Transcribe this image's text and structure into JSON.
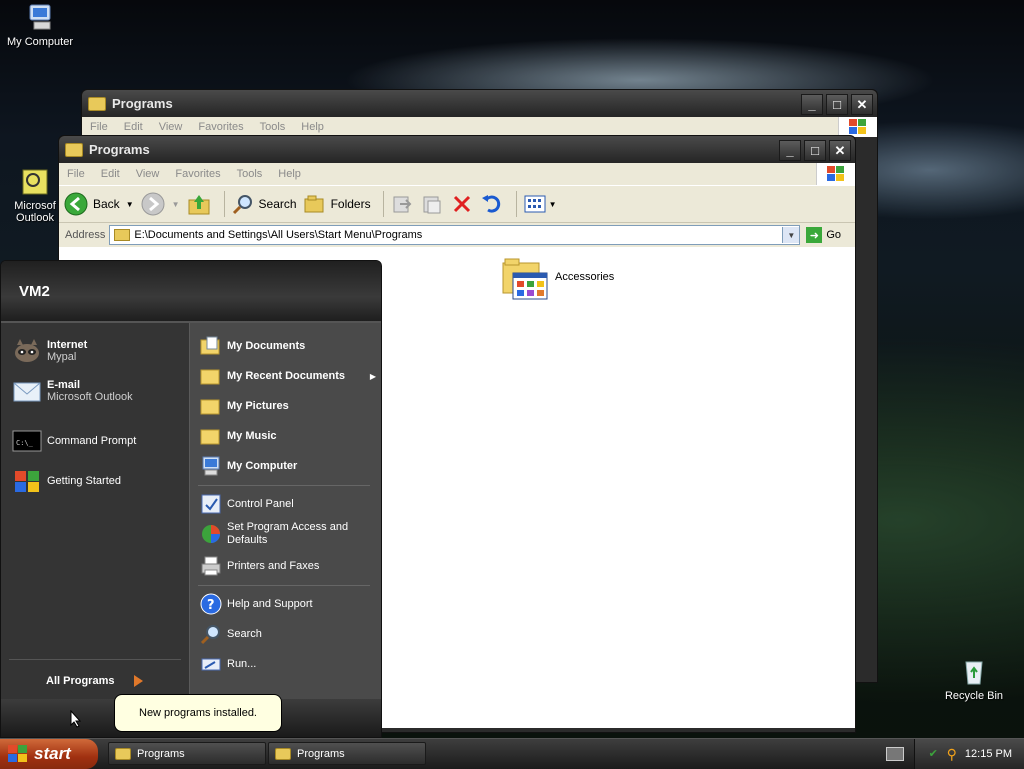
{
  "desktop": {
    "icons": [
      {
        "label": "My Computer",
        "icon": "my-computer-icon"
      },
      {
        "label": "Microsof Outlook",
        "icon": "outlook-icon"
      },
      {
        "label": "Recycle Bin",
        "icon": "recycle-bin-icon"
      }
    ]
  },
  "back_window": {
    "title": "Programs",
    "menu": [
      "File",
      "Edit",
      "View",
      "Favorites",
      "Tools",
      "Help"
    ]
  },
  "front_window": {
    "title": "Programs",
    "menu": [
      "File",
      "Edit",
      "View",
      "Favorites",
      "Tools",
      "Help"
    ],
    "toolbar": {
      "back_label": "Back",
      "search_label": "Search",
      "folders_label": "Folders"
    },
    "address": {
      "label": "Address",
      "value": "E:\\Documents and Settings\\All Users\\Start Menu\\Programs",
      "go_label": "Go"
    },
    "items": [
      {
        "label": "Accessories",
        "icon": "accessories-folder-icon"
      }
    ]
  },
  "start_menu": {
    "user": "VM2",
    "pinned": [
      {
        "title": "Internet",
        "subtitle": "Mypal",
        "icon": "mypal-raccoon-icon"
      },
      {
        "title": "E-mail",
        "subtitle": "Microsoft Outlook",
        "icon": "email-envelope-icon"
      }
    ],
    "recent": [
      {
        "label": "Command Prompt",
        "icon": "command-prompt-icon"
      },
      {
        "label": "Getting Started",
        "icon": "windows-flag-icon"
      }
    ],
    "all_programs": "All Programs",
    "places": [
      {
        "label": "My Documents",
        "icon": "my-documents-icon",
        "bold": true
      },
      {
        "label": "My Recent Documents",
        "icon": "recent-documents-icon",
        "bold": true,
        "submenu": true
      },
      {
        "label": "My Pictures",
        "icon": "my-pictures-icon",
        "bold": true
      },
      {
        "label": "My Music",
        "icon": "my-music-icon",
        "bold": true
      },
      {
        "label": "My Computer",
        "icon": "my-computer-icon",
        "bold": true
      }
    ],
    "settings": [
      {
        "label": "Control Panel",
        "icon": "control-panel-icon"
      },
      {
        "label": "Set Program Access and Defaults",
        "icon": "program-access-icon"
      },
      {
        "label": "Printers and Faxes",
        "icon": "printer-icon"
      }
    ],
    "help": [
      {
        "label": "Help and Support",
        "icon": "help-icon"
      },
      {
        "label": "Search",
        "icon": "search-icon"
      },
      {
        "label": "Run...",
        "icon": "run-icon"
      }
    ]
  },
  "tooltip": {
    "text": "New programs installed."
  },
  "taskbar": {
    "start_label": "start",
    "buttons": [
      "Programs",
      "Programs"
    ],
    "clock": "12:15 PM"
  }
}
